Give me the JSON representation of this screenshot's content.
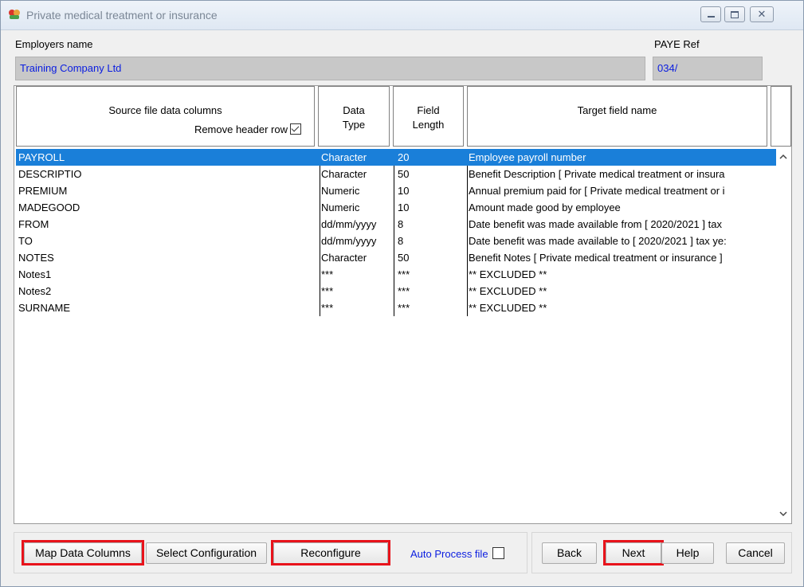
{
  "window": {
    "title": "Private medical treatment or insurance"
  },
  "employer": {
    "label": "Employers name",
    "value": "Training Company Ltd"
  },
  "paye": {
    "label": "PAYE Ref",
    "value": "034/"
  },
  "grid": {
    "headers": {
      "source": "Source file data columns",
      "remove_header": "Remove header row",
      "remove_header_checked": true,
      "data_type_1": "Data",
      "data_type_2": "Type",
      "field_length_1": "Field",
      "field_length_2": "Length",
      "target": "Target field name"
    },
    "rows": [
      {
        "source": "PAYROLL",
        "type": "Character",
        "length": "20",
        "target": "Employee payroll number",
        "selected": true
      },
      {
        "source": "DESCRIPTIO",
        "type": "Character",
        "length": "50",
        "target": "Benefit Description [ Private medical treatment or insura"
      },
      {
        "source": "PREMIUM",
        "type": "Numeric",
        "length": "10",
        "target": "Annual premium paid for [ Private medical treatment or i"
      },
      {
        "source": "MADEGOOD",
        "type": "Numeric",
        "length": "10",
        "target": "Amount made good by employee"
      },
      {
        "source": "FROM",
        "type": "dd/mm/yyyy",
        "length": "8",
        "target": "Date benefit was made available from [ 2020/2021 ] tax"
      },
      {
        "source": "TO",
        "type": "dd/mm/yyyy",
        "length": "8",
        "target": "Date benefit was made available to [ 2020/2021 ] tax ye:"
      },
      {
        "source": "NOTES",
        "type": "Character",
        "length": "50",
        "target": "Benefit Notes [ Private medical treatment or insurance ]"
      },
      {
        "source": "Notes1",
        "type": "***",
        "length": "***",
        "target": "** EXCLUDED **"
      },
      {
        "source": "Notes2",
        "type": "***",
        "length": "***",
        "target": "** EXCLUDED **"
      },
      {
        "source": "SURNAME",
        "type": "***",
        "length": "***",
        "target": "** EXCLUDED **"
      }
    ]
  },
  "buttons": {
    "map_data_columns": "Map Data Columns",
    "select_configuration": "Select Configuration",
    "reconfigure": "Reconfigure",
    "auto_process": "Auto Process file",
    "back": "Back",
    "next": "Next",
    "help": "Help",
    "cancel": "Cancel"
  },
  "colors": {
    "highlight": "#e8131b",
    "selection": "#1a7fd9",
    "link_text": "#0a1de0"
  },
  "icons": {
    "app": "app-icon",
    "minimize": "minimize-icon",
    "maximize": "maximize-icon",
    "close": "close-icon",
    "scroll_up": "scroll-up-arrow-icon",
    "scroll_down": "scroll-down-arrow-icon"
  }
}
